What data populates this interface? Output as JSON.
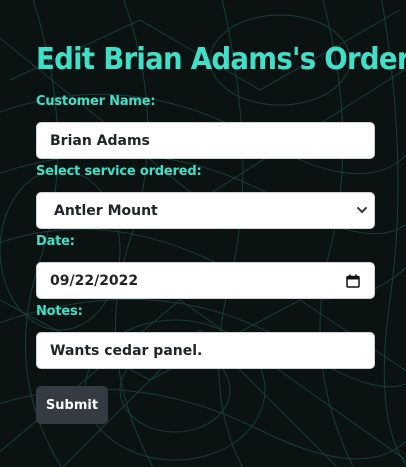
{
  "form": {
    "title": "Edit Brian Adams's Order",
    "customer_name_label": "Customer Name:",
    "customer_name_value": "Brian Adams",
    "service_label": "Select service ordered:",
    "service_selected": "Antler Mount",
    "date_label": "Date:",
    "date_value": "09/22/2022",
    "notes_label": "Notes:",
    "notes_value": "Wants cedar panel.",
    "submit_label": "Submit"
  },
  "colors": {
    "accent": "#40e0c8",
    "background": "#0b1212",
    "button": "#353b42"
  },
  "icons": {
    "select": "chevron-down-icon",
    "date": "calendar-icon"
  }
}
